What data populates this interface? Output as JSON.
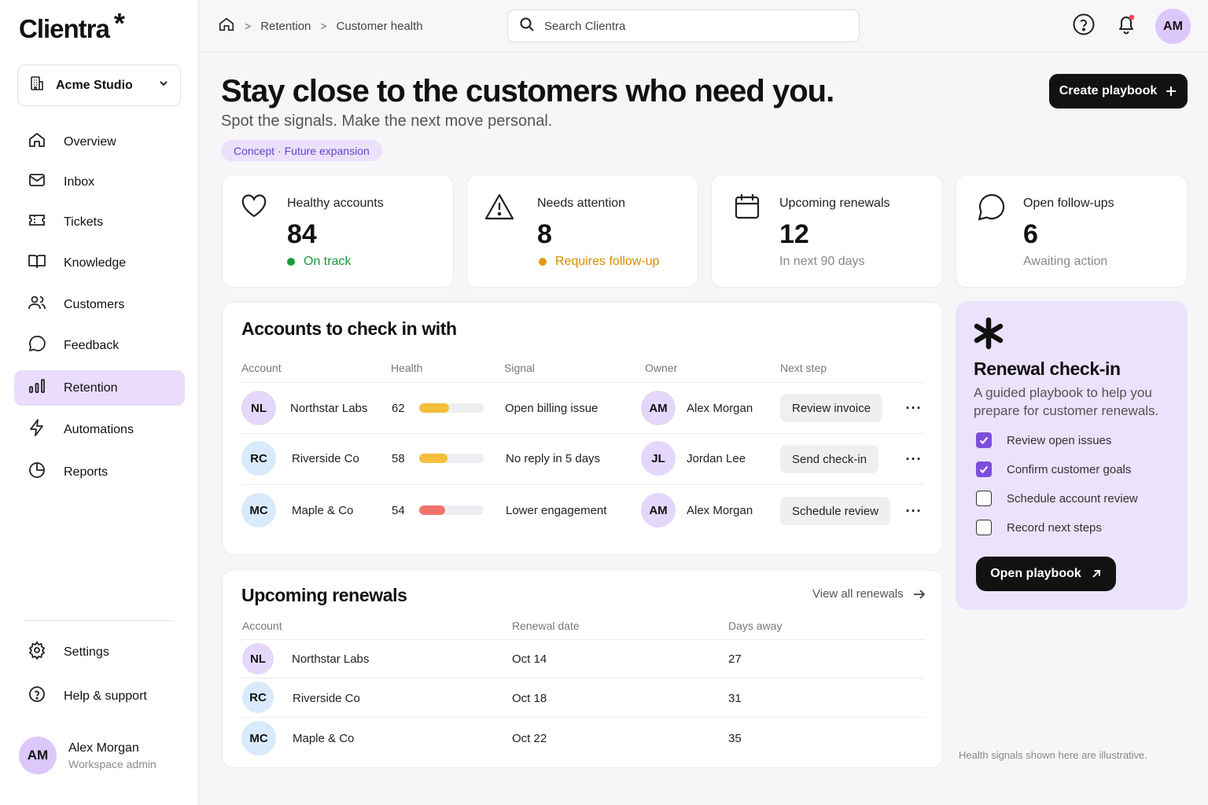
{
  "app": {
    "name": "Clientra",
    "logo_star": "*"
  },
  "workspace": {
    "name": "Acme Studio"
  },
  "sidebar": {
    "items": [
      {
        "label": "Overview",
        "icon": "home-icon"
      },
      {
        "label": "Inbox",
        "icon": "mail-icon"
      },
      {
        "label": "Tickets",
        "icon": "ticket-icon"
      },
      {
        "label": "Knowledge",
        "icon": "book-icon"
      },
      {
        "label": "Customers",
        "icon": "users-icon"
      },
      {
        "label": "Feedback",
        "icon": "chat-icon"
      },
      {
        "label": "Retention",
        "icon": "bar-chart-icon",
        "active": true
      },
      {
        "label": "Automations",
        "icon": "bolt-icon"
      },
      {
        "label": "Reports",
        "icon": "pie-icon"
      }
    ],
    "bottom": [
      {
        "label": "Settings",
        "icon": "gear-icon"
      },
      {
        "label": "Help & support",
        "icon": "help-icon"
      }
    ],
    "user": {
      "initials": "AM",
      "name": "Alex Morgan",
      "role": "Workspace admin"
    }
  },
  "topbar": {
    "breadcrumb": [
      "Retention",
      "Customer health"
    ],
    "search_placeholder": "Search Clientra",
    "avatar_initials": "AM"
  },
  "hero": {
    "title": "Stay close to the customers who need you.",
    "subtitle": "Spot the signals. Make the next move personal.",
    "tag": "Concept · Future expansion",
    "create_button": "Create playbook"
  },
  "stats": [
    {
      "label": "Healthy accounts",
      "value": "84",
      "note": "On track",
      "note_color": "#1a9a3a",
      "dot": "#1a9a3a",
      "icon": "heart-icon"
    },
    {
      "label": "Needs attention",
      "value": "8",
      "note": "Requires follow-up",
      "note_color": "#d98b00",
      "dot": "#e39a10",
      "icon": "warning-icon"
    },
    {
      "label": "Upcoming renewals",
      "value": "12",
      "note": "In next 90 days",
      "note_color": "#888888",
      "icon": "calendar-icon"
    },
    {
      "label": "Open follow-ups",
      "value": "6",
      "note": "Awaiting action",
      "note_color": "#888888",
      "icon": "message-icon"
    }
  ],
  "accounts": {
    "title": "Accounts to check in with",
    "columns": [
      "Account",
      "Health",
      "Signal",
      "Owner",
      "Next step"
    ],
    "rows": [
      {
        "initials": "NL",
        "name": "Northstar Labs",
        "health": "62",
        "health_fraction": 0.62,
        "bar_color": "#f5bf3a",
        "signal": "Open billing issue",
        "owner_initials": "AM",
        "owner": "Alex Morgan",
        "next_step": "Review invoice",
        "avatar": "purple",
        "owner_avatar": "purple"
      },
      {
        "initials": "RC",
        "name": "Riverside Co",
        "health": "58",
        "health_fraction": 0.58,
        "bar_color": "#f5bf3a",
        "signal": "No reply in 5 days",
        "owner_initials": "JL",
        "owner": "Jordan Lee",
        "next_step": "Send check-in",
        "avatar": "blue",
        "owner_avatar": "purple"
      },
      {
        "initials": "MC",
        "name": "Maple & Co",
        "health": "54",
        "health_fraction": 0.54,
        "bar_color": "#f0736a",
        "signal": "Lower engagement",
        "owner_initials": "AM",
        "owner": "Alex Morgan",
        "next_step": "Schedule review",
        "avatar": "blue",
        "owner_avatar": "purple"
      }
    ]
  },
  "renewals": {
    "title": "Upcoming renewals",
    "view_all": "View all renewals",
    "columns": [
      "Account",
      "Renewal date",
      "Days away"
    ],
    "rows": [
      {
        "initials": "NL",
        "name": "Northstar Labs",
        "date": "Oct 14",
        "days": "27",
        "avatar": "purple"
      },
      {
        "initials": "RC",
        "name": "Riverside Co",
        "date": "Oct 18",
        "days": "31",
        "avatar": "blue"
      },
      {
        "initials": "MC",
        "name": "Maple & Co",
        "date": "Oct 22",
        "days": "35",
        "avatar": "blue"
      }
    ]
  },
  "playbook": {
    "title": "Renewal check-in",
    "description": "A guided playbook to help you prepare for customer renewals.",
    "checklist": [
      {
        "label": "Review open issues",
        "checked": true
      },
      {
        "label": "Confirm customer goals",
        "checked": true
      },
      {
        "label": "Schedule account review",
        "checked": false
      },
      {
        "label": "Record next steps",
        "checked": false
      }
    ],
    "open_button": "Open playbook"
  },
  "footnote": "Health signals shown here are illustrative.",
  "colors": {
    "accent": "#7c4ddc",
    "active_nav": "#e9dcfd",
    "panel": "#ebe2fb"
  }
}
